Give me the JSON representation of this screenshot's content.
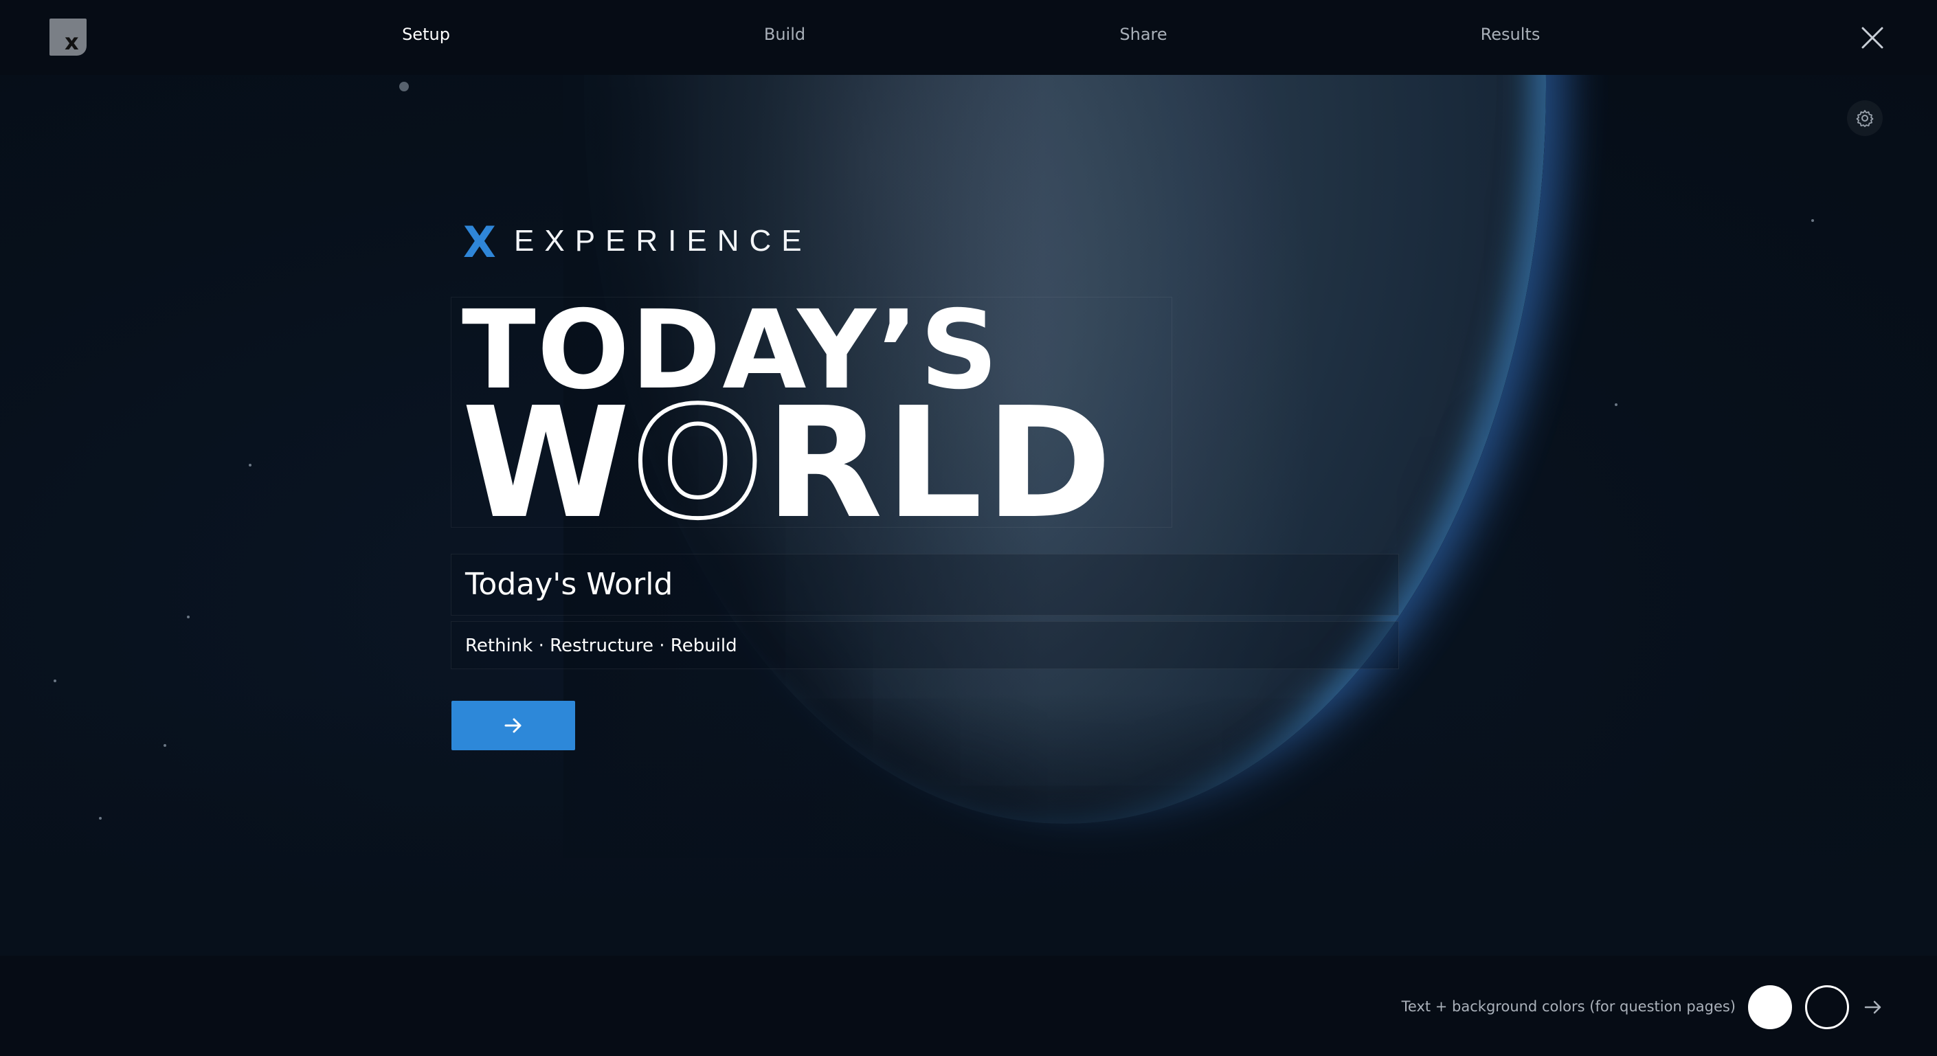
{
  "nav": {
    "logo_letter": "x",
    "steps": [
      "Setup",
      "Build",
      "Share",
      "Results"
    ],
    "active_step": "Setup"
  },
  "cover": {
    "brand_mark": "X",
    "brand_word": "EXPERIENCE",
    "title_line1": "TODAY’S",
    "title_line2_pre": "W",
    "title_line2_o": "O",
    "title_line2_post": "RLD",
    "title_field": "Today's World",
    "subtitle_field": "Rethink · Restructure · Rebuild"
  },
  "footer": {
    "colors_label": "Text + background colors (for question pages)"
  },
  "colors": {
    "accent": "#2d88d9",
    "text_color": "#ffffff",
    "background_color": "#060c15"
  },
  "icons": [
    "logo-icon",
    "close-icon",
    "gear-icon",
    "arrow-right-icon"
  ]
}
